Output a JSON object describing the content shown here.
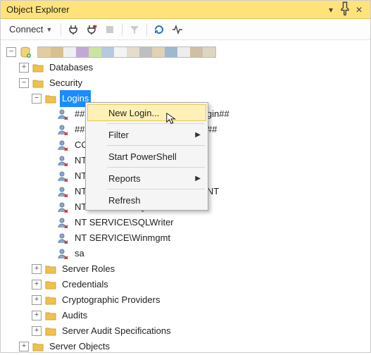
{
  "window": {
    "title": "Object Explorer"
  },
  "toolbar": {
    "connect_label": "Connect"
  },
  "server_colors": [
    "#e3cda0",
    "#d9bf90",
    "#f0f0f0",
    "#c4a8d8",
    "#cde3a0",
    "#b6c9e0",
    "#f4f4f4",
    "#e3dccf",
    "#bfbfbf",
    "#e0d2b3",
    "#9fb8cf",
    "#ededed",
    "#cfbfa5",
    "#dcd6c2"
  ],
  "tree": {
    "databases": "Databases",
    "security": "Security",
    "logins": "Logins",
    "login_items": [
      "##MS_PolicyEventProcessingLogin##",
      "##MS_PolicyTsqlExecutionLogin##",
      "CONTOSO\\Administrator",
      "NT AUTHORITY\\SYSTEM",
      "NT Service\\MSSQLSERVER",
      "NT SERVICE\\SQLSERVERAGENT",
      "NT SERVICE\\SQLTELEMETRY",
      "NT SERVICE\\SQLWriter",
      "NT SERVICE\\Winmgmt",
      "sa"
    ],
    "server_roles": "Server Roles",
    "credentials": "Credentials",
    "crypto_providers": "Cryptographic Providers",
    "audits": "Audits",
    "server_audit_specs": "Server Audit Specifications",
    "server_objects": "Server Objects"
  },
  "context_menu": {
    "new_login": "New Login...",
    "filter": "Filter",
    "start_powershell": "Start PowerShell",
    "reports": "Reports",
    "refresh": "Refresh"
  }
}
